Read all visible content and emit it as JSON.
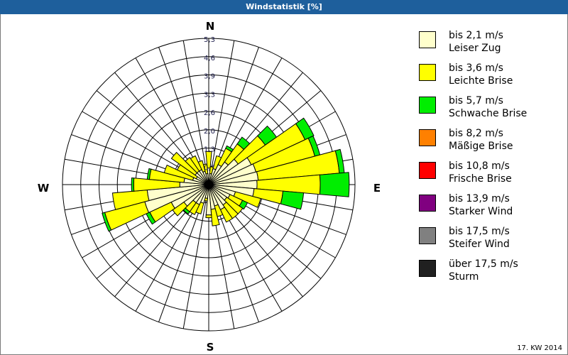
{
  "title": "Windstatistik [%]",
  "footer": "17. KW 2014",
  "chart_data": {
    "type": "windrose",
    "title": "Windstatistik [%]",
    "compass_labels": {
      "N": "N",
      "E": "E",
      "S": "S",
      "W": "W"
    },
    "radial_ticks": [
      "0,7",
      "1,3",
      "2,0",
      "2,6",
      "3,3",
      "3,9",
      "4,6",
      "5,3"
    ],
    "rmax": 5.3,
    "grid": true,
    "legend_position": "right",
    "directions_deg": [
      0,
      10,
      20,
      30,
      40,
      50,
      60,
      70,
      80,
      90,
      100,
      110,
      120,
      130,
      140,
      150,
      160,
      170,
      180,
      190,
      200,
      210,
      220,
      230,
      240,
      250,
      260,
      270,
      280,
      290,
      300,
      310,
      320,
      330,
      340,
      350
    ],
    "series": [
      {
        "name": "bis 2,1 m/s",
        "color": "#FFFFCC",
        "values": [
          0.6,
          0.4,
          0.6,
          0.8,
          1.0,
          1.3,
          1.7,
          1.77,
          1.8,
          1.75,
          1.65,
          1.0,
          0.85,
          0.8,
          0.9,
          1.0,
          0.8,
          0.9,
          1.1,
          0.5,
          0.7,
          0.8,
          0.8,
          1.1,
          1.5,
          2.4,
          2.24,
          1.05,
          0.9,
          0.6,
          0.5,
          0.6,
          0.6,
          0.6,
          0.5,
          0.4
        ]
      },
      {
        "name": "bis 3,6 m/s",
        "color": "#FFFF00",
        "values": [
          0.6,
          0.25,
          0.48,
          0.65,
          0.8,
          1.2,
          2.15,
          2.21,
          2.95,
          2.29,
          1.05,
          0.95,
          0.5,
          0.7,
          0.6,
          0.5,
          0.4,
          0.6,
          0.1,
          0.1,
          0.4,
          0.4,
          0.4,
          0.5,
          0.86,
          1.5,
          1.26,
          1.67,
          1.26,
          1.07,
          0.76,
          1.05,
          0.6,
          0.55,
          0.4,
          0.35
        ]
      },
      {
        "name": "bis 5,7 m/s",
        "color": "#00EE00",
        "values": [
          0,
          0,
          0,
          0.1,
          0.3,
          0.5,
          0.35,
          0.19,
          0.18,
          1.05,
          0.75,
          0,
          0.2,
          0,
          0,
          0,
          0,
          0,
          0,
          0,
          0,
          0,
          0.1,
          0,
          0.14,
          0.1,
          0,
          0.08,
          0.08,
          0,
          0,
          0,
          0,
          0,
          0,
          0
        ]
      }
    ]
  },
  "legend": [
    {
      "line1": "bis 2,1 m/s",
      "line2": "Leiser Zug",
      "color": "#FFFFCC"
    },
    {
      "line1": "bis 3,6 m/s",
      "line2": "Leichte Brise",
      "color": "#FFFF00"
    },
    {
      "line1": "bis 5,7 m/s",
      "line2": "Schwache Brise",
      "color": "#00EE00"
    },
    {
      "line1": "bis 8,2 m/s",
      "line2": "Mäßige Brise",
      "color": "#FF8000"
    },
    {
      "line1": "bis 10,8 m/s",
      "line2": "Frische Brise",
      "color": "#FF0000"
    },
    {
      "line1": "bis 13,9 m/s",
      "line2": "Starker Wind",
      "color": "#800080"
    },
    {
      "line1": "bis 17,5 m/s",
      "line2": "Steifer Wind",
      "color": "#808080"
    },
    {
      "line1": "über 17,5 m/s",
      "line2": "Sturm",
      "color": "#202020"
    }
  ]
}
